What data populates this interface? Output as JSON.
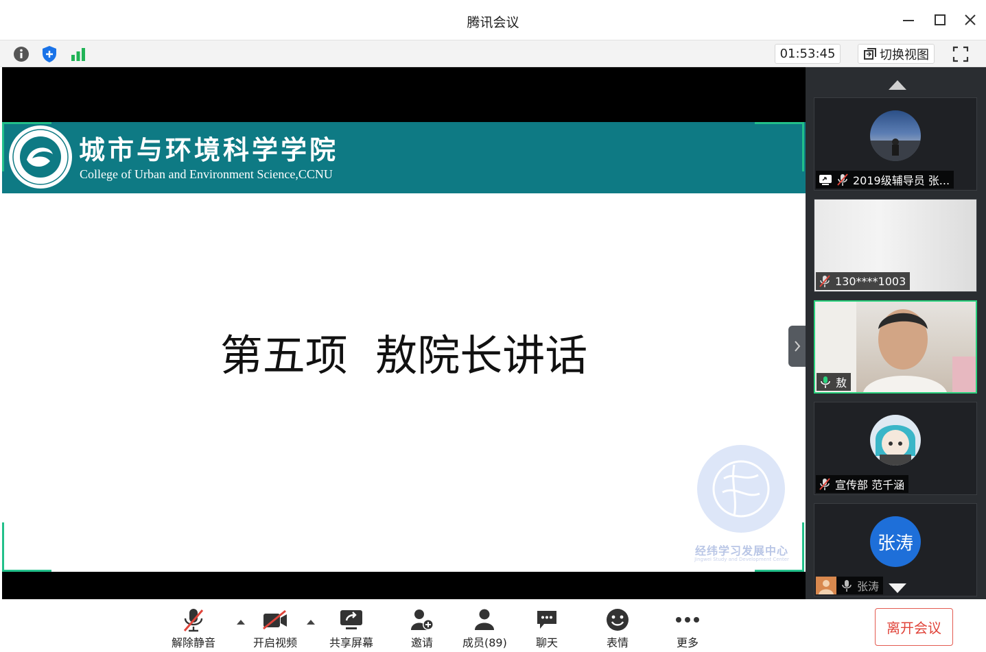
{
  "window": {
    "title": "腾讯会议"
  },
  "toolbar": {
    "info_icon": "info-icon",
    "security_icon": "shield-icon",
    "signal_icon": "signal-bars-icon",
    "timer": "01:53:45",
    "switch_view_label": "切换视图"
  },
  "slide": {
    "college_cn": "城市与环境科学学院",
    "college_en": "College of Urban and Environment Science,CCNU",
    "heading": "第五项  敖院长讲话",
    "watermark_cn": "经纬学习发展中心",
    "watermark_en": "Jingwei Study and Development Center"
  },
  "participants": [
    {
      "name": "2019级辅导员 张...",
      "muted": true,
      "sharing": true
    },
    {
      "name": "130****1003",
      "muted": true
    },
    {
      "name": "敖",
      "muted": false,
      "speaking": true
    },
    {
      "name": "宣传部 范千涵",
      "muted": true
    },
    {
      "name": "张涛",
      "avatar_text": "张涛",
      "muted": false
    }
  ],
  "controls": {
    "unmute": "解除静音",
    "start_video": "开启视频",
    "share_screen": "共享屏幕",
    "invite": "邀请",
    "members": "成员(89)",
    "chat": "聊天",
    "reactions": "表情",
    "more": "更多",
    "leave": "离开会议"
  },
  "colors": {
    "accent_green": "#22c08a",
    "banner_teal": "#0e7a84",
    "leave_red": "#e0443a",
    "avatar_blue": "#1e6fd9"
  }
}
